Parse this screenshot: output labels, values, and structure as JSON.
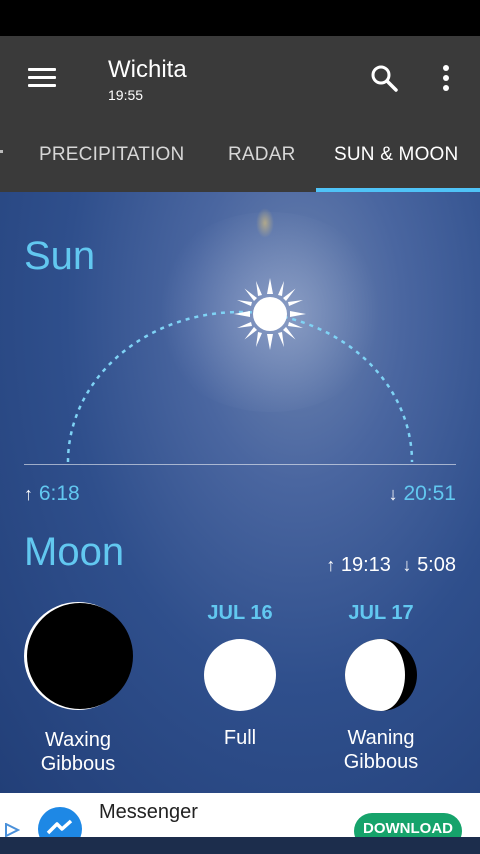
{
  "app_bar": {
    "city": "Wichita",
    "time": "19:55"
  },
  "tabs": [
    {
      "label": "PRECIPITATION",
      "active": false
    },
    {
      "label": "RADAR",
      "active": false
    },
    {
      "label": "SUN & MOON",
      "active": true
    }
  ],
  "sun": {
    "heading": "Sun",
    "sunrise": "6:18",
    "sunset": "20:51"
  },
  "moon": {
    "heading": "Moon",
    "rise": "19:13",
    "set": "5:08",
    "phases": [
      {
        "date": "",
        "name_line1": "Waxing",
        "name_line2": "Gibbous"
      },
      {
        "date": "JUL 16",
        "name_line1": "Full",
        "name_line2": ""
      },
      {
        "date": "JUL 17",
        "name_line1": "Waning",
        "name_line2": "Gibbous"
      }
    ]
  },
  "ad": {
    "app_name": "Messenger",
    "cta": "DOWNLOAD"
  },
  "colors": {
    "accent": "#62c8f0",
    "toolbar": "#3a3a3a",
    "ad_button": "#16a36b"
  }
}
